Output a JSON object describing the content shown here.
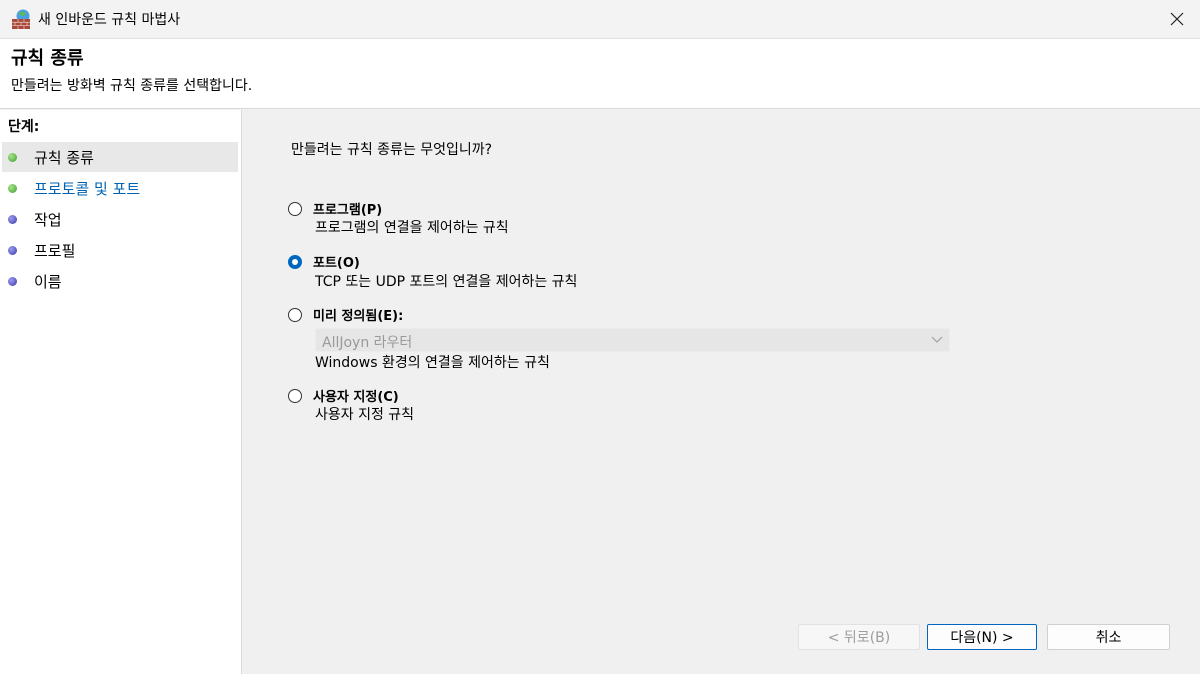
{
  "window": {
    "title": "새 인바운드 규칙 마법사"
  },
  "header": {
    "title": "규칙 종류",
    "subtitle": "만들려는 방화벽 규칙 종류를 선택합니다."
  },
  "sidebar": {
    "title": "단계:",
    "items": [
      {
        "label": "규칙 종류",
        "status": "green",
        "active": true
      },
      {
        "label": "프로토콜 및 포트",
        "status": "green",
        "active": false
      },
      {
        "label": "작업",
        "status": "blue",
        "active": false
      },
      {
        "label": "프로필",
        "status": "blue",
        "active": false
      },
      {
        "label": "이름",
        "status": "blue",
        "active": false
      }
    ]
  },
  "main": {
    "question": "만들려는 규칙 종류는 무엇입니까?",
    "options": [
      {
        "label": "프로그램(P)",
        "description": "프로그램의 연결을 제어하는 규칙",
        "checked": false
      },
      {
        "label": "포트(O)",
        "description": "TCP 또는 UDP 포트의 연결을 제어하는 규칙",
        "checked": true
      },
      {
        "label": "미리 정의됨(E):",
        "dropdown_value": "AllJoyn 라우터",
        "description": "Windows 환경의 연결을 제어하는 규칙",
        "checked": false
      },
      {
        "label": "사용자 지정(C)",
        "description": "사용자 지정 규칙",
        "checked": false
      }
    ]
  },
  "buttons": {
    "back": "< 뒤로(B)",
    "next": "다음(N) >",
    "cancel": "취소"
  },
  "colors": {
    "accent": "#0067c0",
    "link": "#0063b1",
    "status_green": "#3e9e2c",
    "status_blue": "#3a3aa8"
  },
  "icons": {
    "app": "firewall-bricks-globe-icon",
    "close": "close-icon",
    "dropdown": "chevron-down-icon"
  }
}
